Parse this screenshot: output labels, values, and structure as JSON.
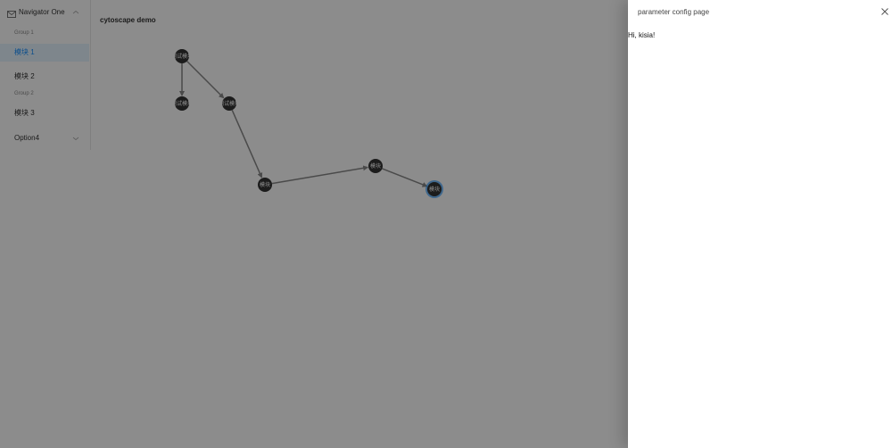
{
  "sidebar": {
    "navigator_one": {
      "label": "Navigator One"
    },
    "groups": [
      {
        "title": "Group 1",
        "items": [
          {
            "label": "模块 1",
            "selected": true
          },
          {
            "label": "模块 2"
          }
        ]
      },
      {
        "title": "Group 2",
        "items": [
          {
            "label": "模块 3"
          }
        ]
      }
    ],
    "option4": {
      "label": "Option4"
    }
  },
  "content": {
    "title": "cytoscape demo",
    "graph": {
      "nodes": [
        {
          "id": "n1",
          "label": "测试模块"
        },
        {
          "id": "n2",
          "label": "测试模块"
        },
        {
          "id": "n3",
          "label": "测试模块"
        },
        {
          "id": "n4",
          "label": "模块"
        },
        {
          "id": "n5",
          "label": "模块"
        },
        {
          "id": "n6",
          "label": "模块",
          "selected": true
        }
      ],
      "edges": [
        {
          "source": "n1",
          "target": "n2"
        },
        {
          "source": "n1",
          "target": "n3"
        },
        {
          "source": "n3",
          "target": "n4"
        },
        {
          "source": "n4",
          "target": "n5"
        },
        {
          "source": "n5",
          "target": "n6"
        }
      ]
    }
  },
  "drawer": {
    "title": "parameter config page",
    "body": "Hi, kisia!"
  },
  "colors": {
    "accent": "#1890ff",
    "node": "#333333",
    "edge": "#888888"
  }
}
